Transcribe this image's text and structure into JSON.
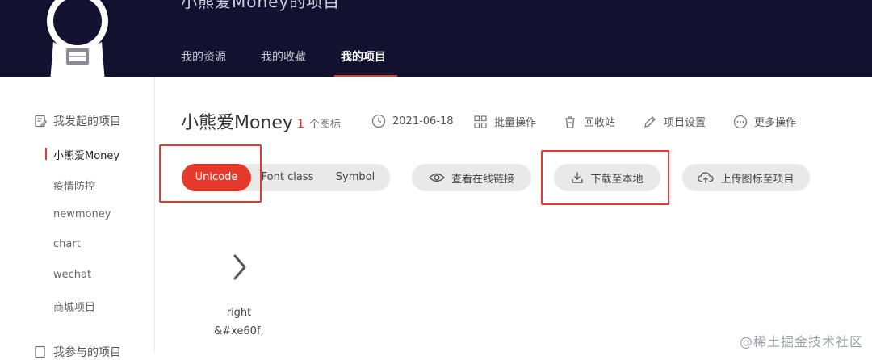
{
  "header": {
    "title": "小熊爱Money的项目",
    "tabs": [
      {
        "label": "我的资源"
      },
      {
        "label": "我的收藏"
      },
      {
        "label": "我的项目"
      }
    ]
  },
  "sidebar": {
    "initiated_heading": "我发起的项目",
    "items": [
      {
        "label": "小熊爱Money"
      },
      {
        "label": "疫情防控"
      },
      {
        "label": "newmoney"
      },
      {
        "label": "chart"
      },
      {
        "label": "wechat"
      },
      {
        "label": "商城项目"
      }
    ],
    "joined_heading": "我参与的项目"
  },
  "project": {
    "name": "小熊爱Money",
    "icon_count": "1",
    "icon_count_unit": "个图标",
    "date": "2021-06-18",
    "batch": "批量操作",
    "trash": "回收站",
    "settings": "项目设置",
    "more": "更多操作"
  },
  "toolbar": {
    "unicode": "Unicode",
    "font_class": "Font class",
    "symbol": "Symbol",
    "online_link": "查看在线链接",
    "download": "下载至本地",
    "upload": "上传图标至项目"
  },
  "icons": [
    {
      "name": "right",
      "code": "&#xe60f;"
    }
  ],
  "watermark": "@稀土掘金技术社区",
  "colors": {
    "accent": "#e53935",
    "header_bg": "#121230"
  }
}
